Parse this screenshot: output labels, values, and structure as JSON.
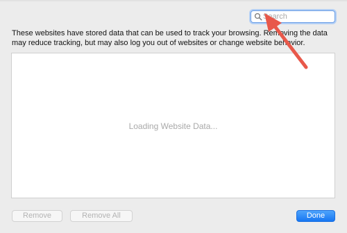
{
  "search": {
    "placeholder": "Search",
    "icon": "magnifying-glass-icon"
  },
  "description": "These websites have stored data that can be used to track your browsing. Removing the data may reduce tracking, but may also log you out of websites or change website behavior.",
  "data_panel": {
    "status_text": "Loading Website Data..."
  },
  "buttons": {
    "remove": "Remove",
    "remove_all": "Remove All",
    "done": "Done"
  },
  "colors": {
    "accent": "#1776f2",
    "annotation_arrow": "#e8584a",
    "focus_ring": "#b3cff5"
  }
}
